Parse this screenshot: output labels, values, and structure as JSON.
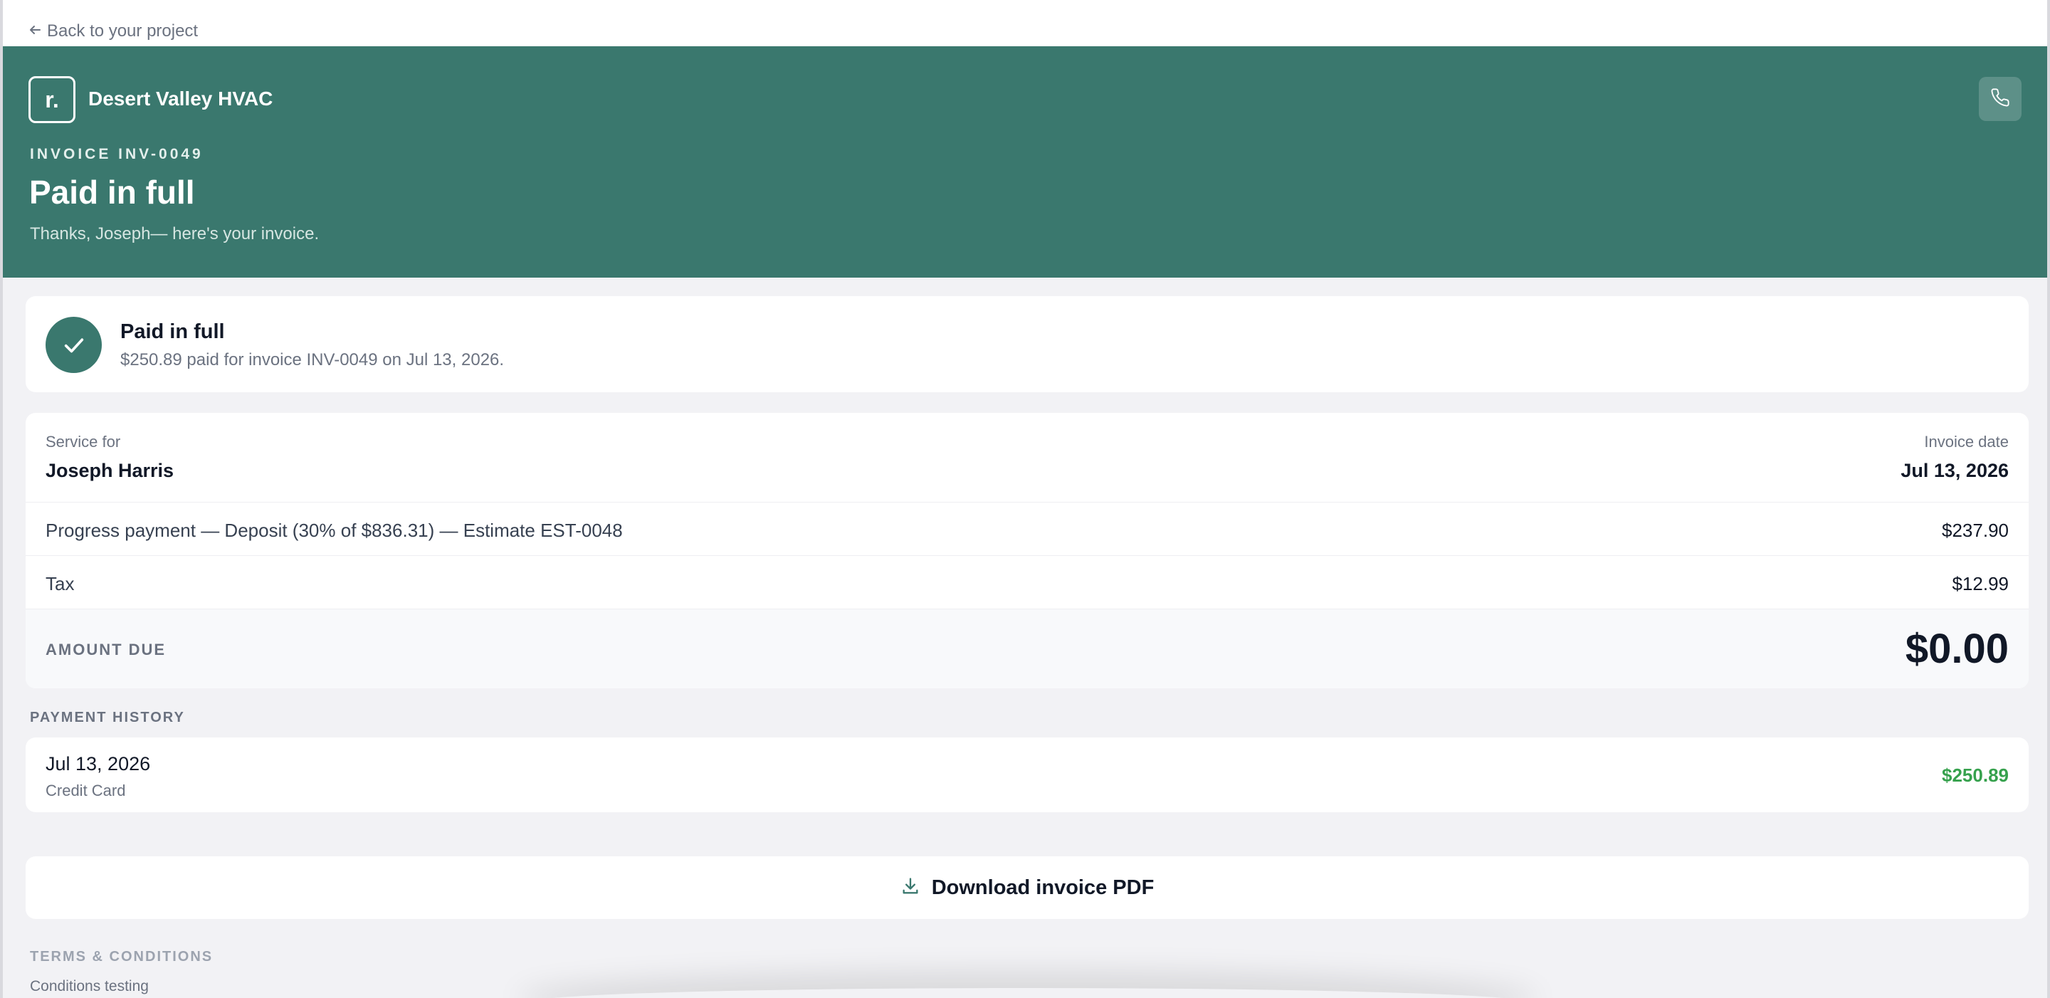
{
  "nav": {
    "back_label": "Back to your project"
  },
  "header": {
    "logo_letter": "r.",
    "company_name": "Desert Valley HVAC",
    "invoice_label": "INVOICE INV-0049",
    "title": "Paid in full",
    "subtitle": "Thanks, Joseph— here's your invoice."
  },
  "status": {
    "title": "Paid in full",
    "description": "$250.89 paid for invoice INV-0049 on Jul 13, 2026."
  },
  "invoice": {
    "service_for_label": "Service for",
    "customer_name": "Joseph Harris",
    "invoice_date_label": "Invoice date",
    "invoice_date": "Jul 13, 2026",
    "line_items": [
      {
        "description": "Progress payment — Deposit (30% of $836.31) — Estimate EST-0048",
        "amount": "$237.90"
      },
      {
        "description": "Tax",
        "amount": "$12.99"
      }
    ],
    "amount_due_label": "AMOUNT DUE",
    "amount_due": "$0.00"
  },
  "payment_history": {
    "label": "PAYMENT HISTORY",
    "entries": [
      {
        "date": "Jul 13, 2026",
        "method": "Credit Card",
        "amount": "$250.89"
      }
    ]
  },
  "download": {
    "label": "Download invoice PDF"
  },
  "terms": {
    "label": "TERMS & CONDITIONS",
    "text": "Conditions testing"
  },
  "colors": {
    "brand": "#3a786e",
    "page_bg": "#f2f2f5",
    "paid_green": "#36a14d",
    "text_primary": "#111827",
    "text_muted": "#6b7280"
  },
  "icons": {
    "back": "arrow-left-icon",
    "phone": "phone-icon",
    "check": "check-icon",
    "download": "download-icon"
  }
}
